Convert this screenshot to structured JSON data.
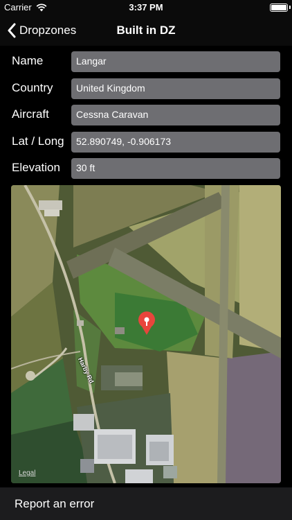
{
  "status_bar": {
    "carrier": "Carrier",
    "time": "3:37 PM",
    "wifi_icon": "wifi-icon",
    "battery_icon": "battery-icon"
  },
  "nav": {
    "back_label": "Dropzones",
    "title": "Built in DZ",
    "back_icon": "chevron-left-icon"
  },
  "form": {
    "rows": [
      {
        "label": "Name",
        "value": "Langar"
      },
      {
        "label": "Country",
        "value": "United Kingdom"
      },
      {
        "label": "Aircraft",
        "value": "Cessna Caravan"
      },
      {
        "label": "Lat / Long",
        "value": "52.890749, -0.906173"
      },
      {
        "label": "Elevation",
        "value": "30 ft"
      }
    ]
  },
  "map": {
    "road_label": "Harby Rd",
    "legal": "Legal",
    "pin_icon": "map-pin-icon"
  },
  "footer": {
    "report_label": "Report an error"
  },
  "colors": {
    "background": "#000000",
    "field": "#6e6e72",
    "pin": "#e8453c",
    "footer": "#1c1c1e"
  }
}
